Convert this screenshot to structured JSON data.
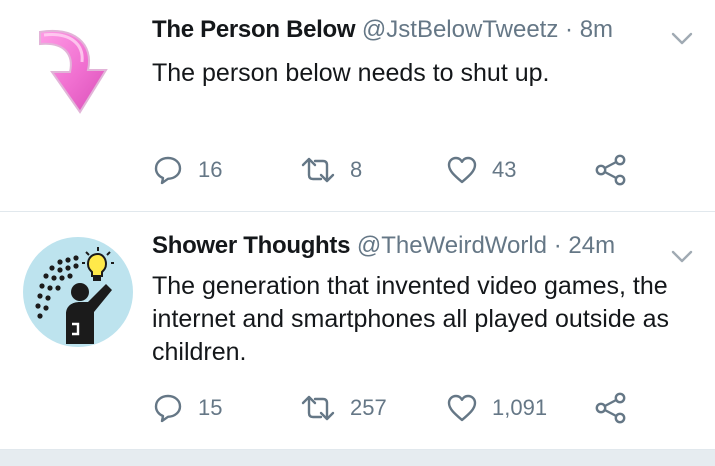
{
  "tweets": [
    {
      "display_name": "The Person Below",
      "handle": "@JstBelowTweetz",
      "separator": "·",
      "time": "8m",
      "text": "The person below needs to shut up.",
      "avatar": "pink-down-arrow-icon",
      "replies": "16",
      "retweets": "8",
      "likes": "43"
    },
    {
      "display_name": "Shower Thoughts",
      "handle": "@TheWeirdWorld",
      "separator": "·",
      "time": "24m",
      "text": "The generation that invented video games, the internet and smartphones all played outside as children.",
      "avatar": "shower-lightbulb-icon",
      "replies": "15",
      "retweets": "257",
      "likes": "1,091"
    }
  ],
  "colors": {
    "secondary_text": "#657786",
    "primary_text": "#14171a",
    "divider": "#e1e8ed",
    "avatar_bg": "#bde3ee",
    "arrow_pink": "#f06fd0"
  }
}
